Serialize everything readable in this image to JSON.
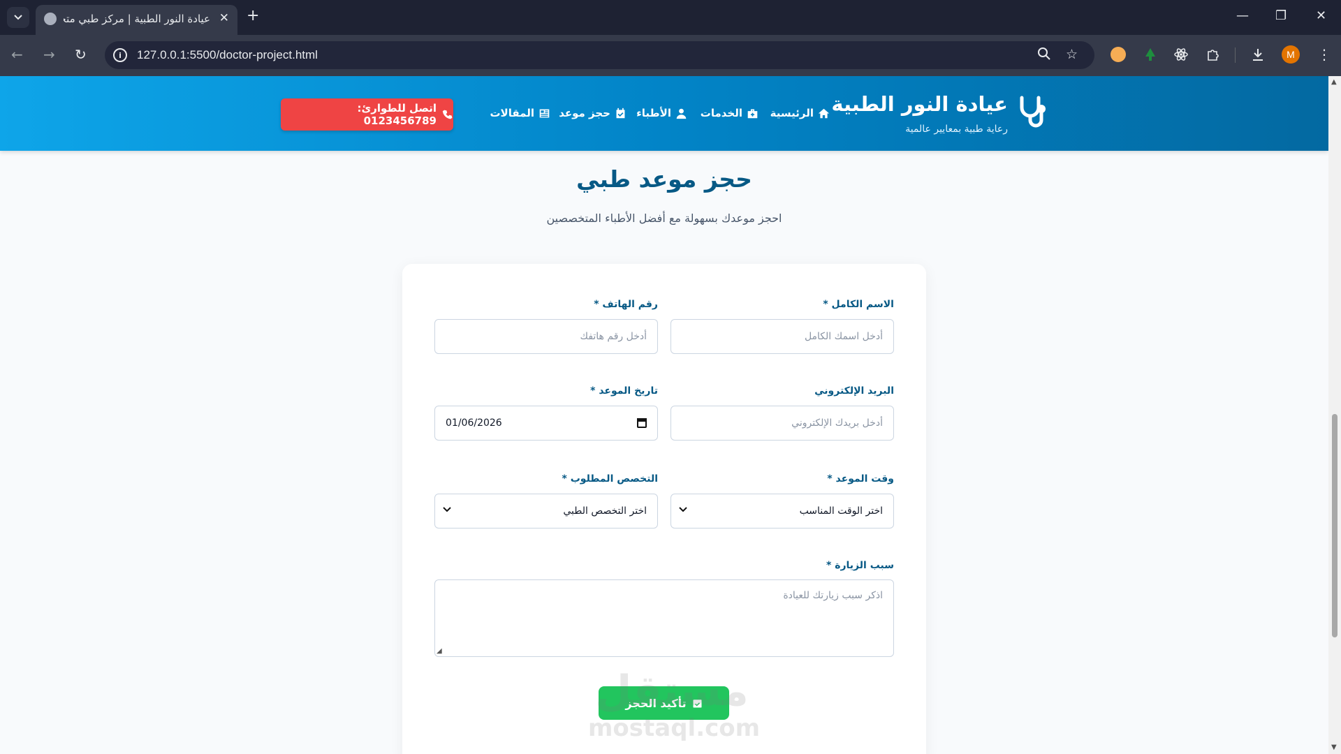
{
  "browser": {
    "tab_title": "عيادة النور الطبية | مركز طبي متخصص",
    "url": "127.0.0.1:5500/doctor-project.html",
    "profile_initial": "M"
  },
  "header": {
    "brand_name": "عيادة النور الطبية",
    "brand_tagline": "رعاية طبية بمعايير عالمية",
    "nav": {
      "home": "الرئيسية",
      "services": "الخدمات",
      "doctors": "الأطباء",
      "booking": "حجز موعد",
      "articles": "المقالات"
    },
    "emergency_label": "اتصل للطوارئ: 0123456789"
  },
  "booking": {
    "title": "حجز موعد طبي",
    "subtitle": "احجز موعدك بسهولة مع أفضل الأطباء المتخصصين",
    "fields": {
      "full_name": {
        "label": "الاسم الكامل *",
        "placeholder": "أدخل اسمك الكامل"
      },
      "phone": {
        "label": "رقم الهاتف *",
        "placeholder": "أدخل رقم هاتفك"
      },
      "email": {
        "label": "البريد الإلكتروني",
        "placeholder": "أدخل بريدك الإلكتروني"
      },
      "date": {
        "label": "تاريخ الموعد *",
        "value": "01/06/2026"
      },
      "time": {
        "label": "وقت الموعد *",
        "value": "اختر الوقت المناسب"
      },
      "specialty": {
        "label": "التخصص المطلوب *",
        "value": "اختر التخصص الطبي"
      },
      "reason": {
        "label": "سبب الزيارة *",
        "placeholder": "اذكر سبب زيارتك للعيادة"
      }
    },
    "submit_label": "تأكيد الحجز"
  },
  "watermark": {
    "arabic": "مستقل",
    "latin": "mostaql.com"
  },
  "colors": {
    "header_gradient_start": "#0ea5e9",
    "header_gradient_end": "#0369a1",
    "emergency": "#ef4444",
    "submit": "#22c55e",
    "title": "#075985"
  }
}
